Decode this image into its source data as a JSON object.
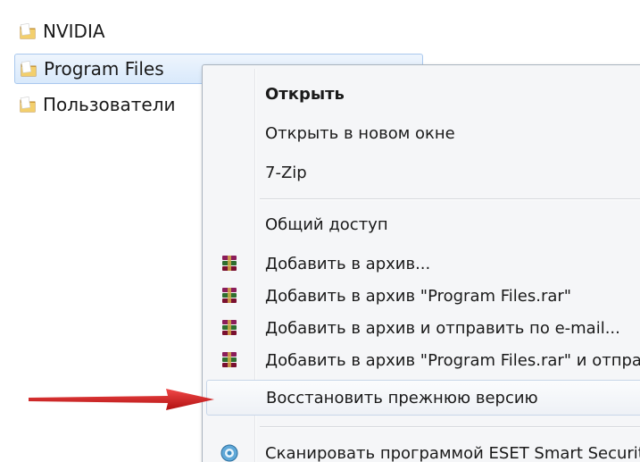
{
  "explorer": {
    "folders": [
      {
        "name": "NVIDIA",
        "icon": "folder-icon"
      },
      {
        "name": "Program Files",
        "icon": "folder-icon",
        "selected": true
      },
      {
        "name": "Пользователи",
        "icon": "folder-icon"
      }
    ]
  },
  "context_menu": {
    "items": [
      {
        "label": "Открыть",
        "bold": true,
        "icon": ""
      },
      {
        "label": "Открыть в новом окне",
        "icon": ""
      },
      {
        "label": "7-Zip",
        "icon": ""
      },
      {
        "label": "Общий доступ",
        "icon": ""
      },
      {
        "label": "Добавить в архив...",
        "icon": "winrar-icon"
      },
      {
        "label": "Добавить в архив \"Program Files.rar\"",
        "icon": "winrar-icon"
      },
      {
        "label": "Добавить в архив и отправить по e-mail...",
        "icon": "winrar-icon"
      },
      {
        "label": "Добавить в архив \"Program Files.rar\" и отправить по e-mail",
        "icon": "winrar-icon"
      },
      {
        "label": "Восстановить прежнюю версию",
        "icon": "",
        "highlighted": true
      },
      {
        "label": "Сканировать программой ESET Smart Security",
        "icon": "eset-icon"
      }
    ]
  },
  "colors": {
    "arrow": "#d41a1a",
    "selection": "#d9e9fb",
    "menu_background": "#f5f6f8"
  }
}
